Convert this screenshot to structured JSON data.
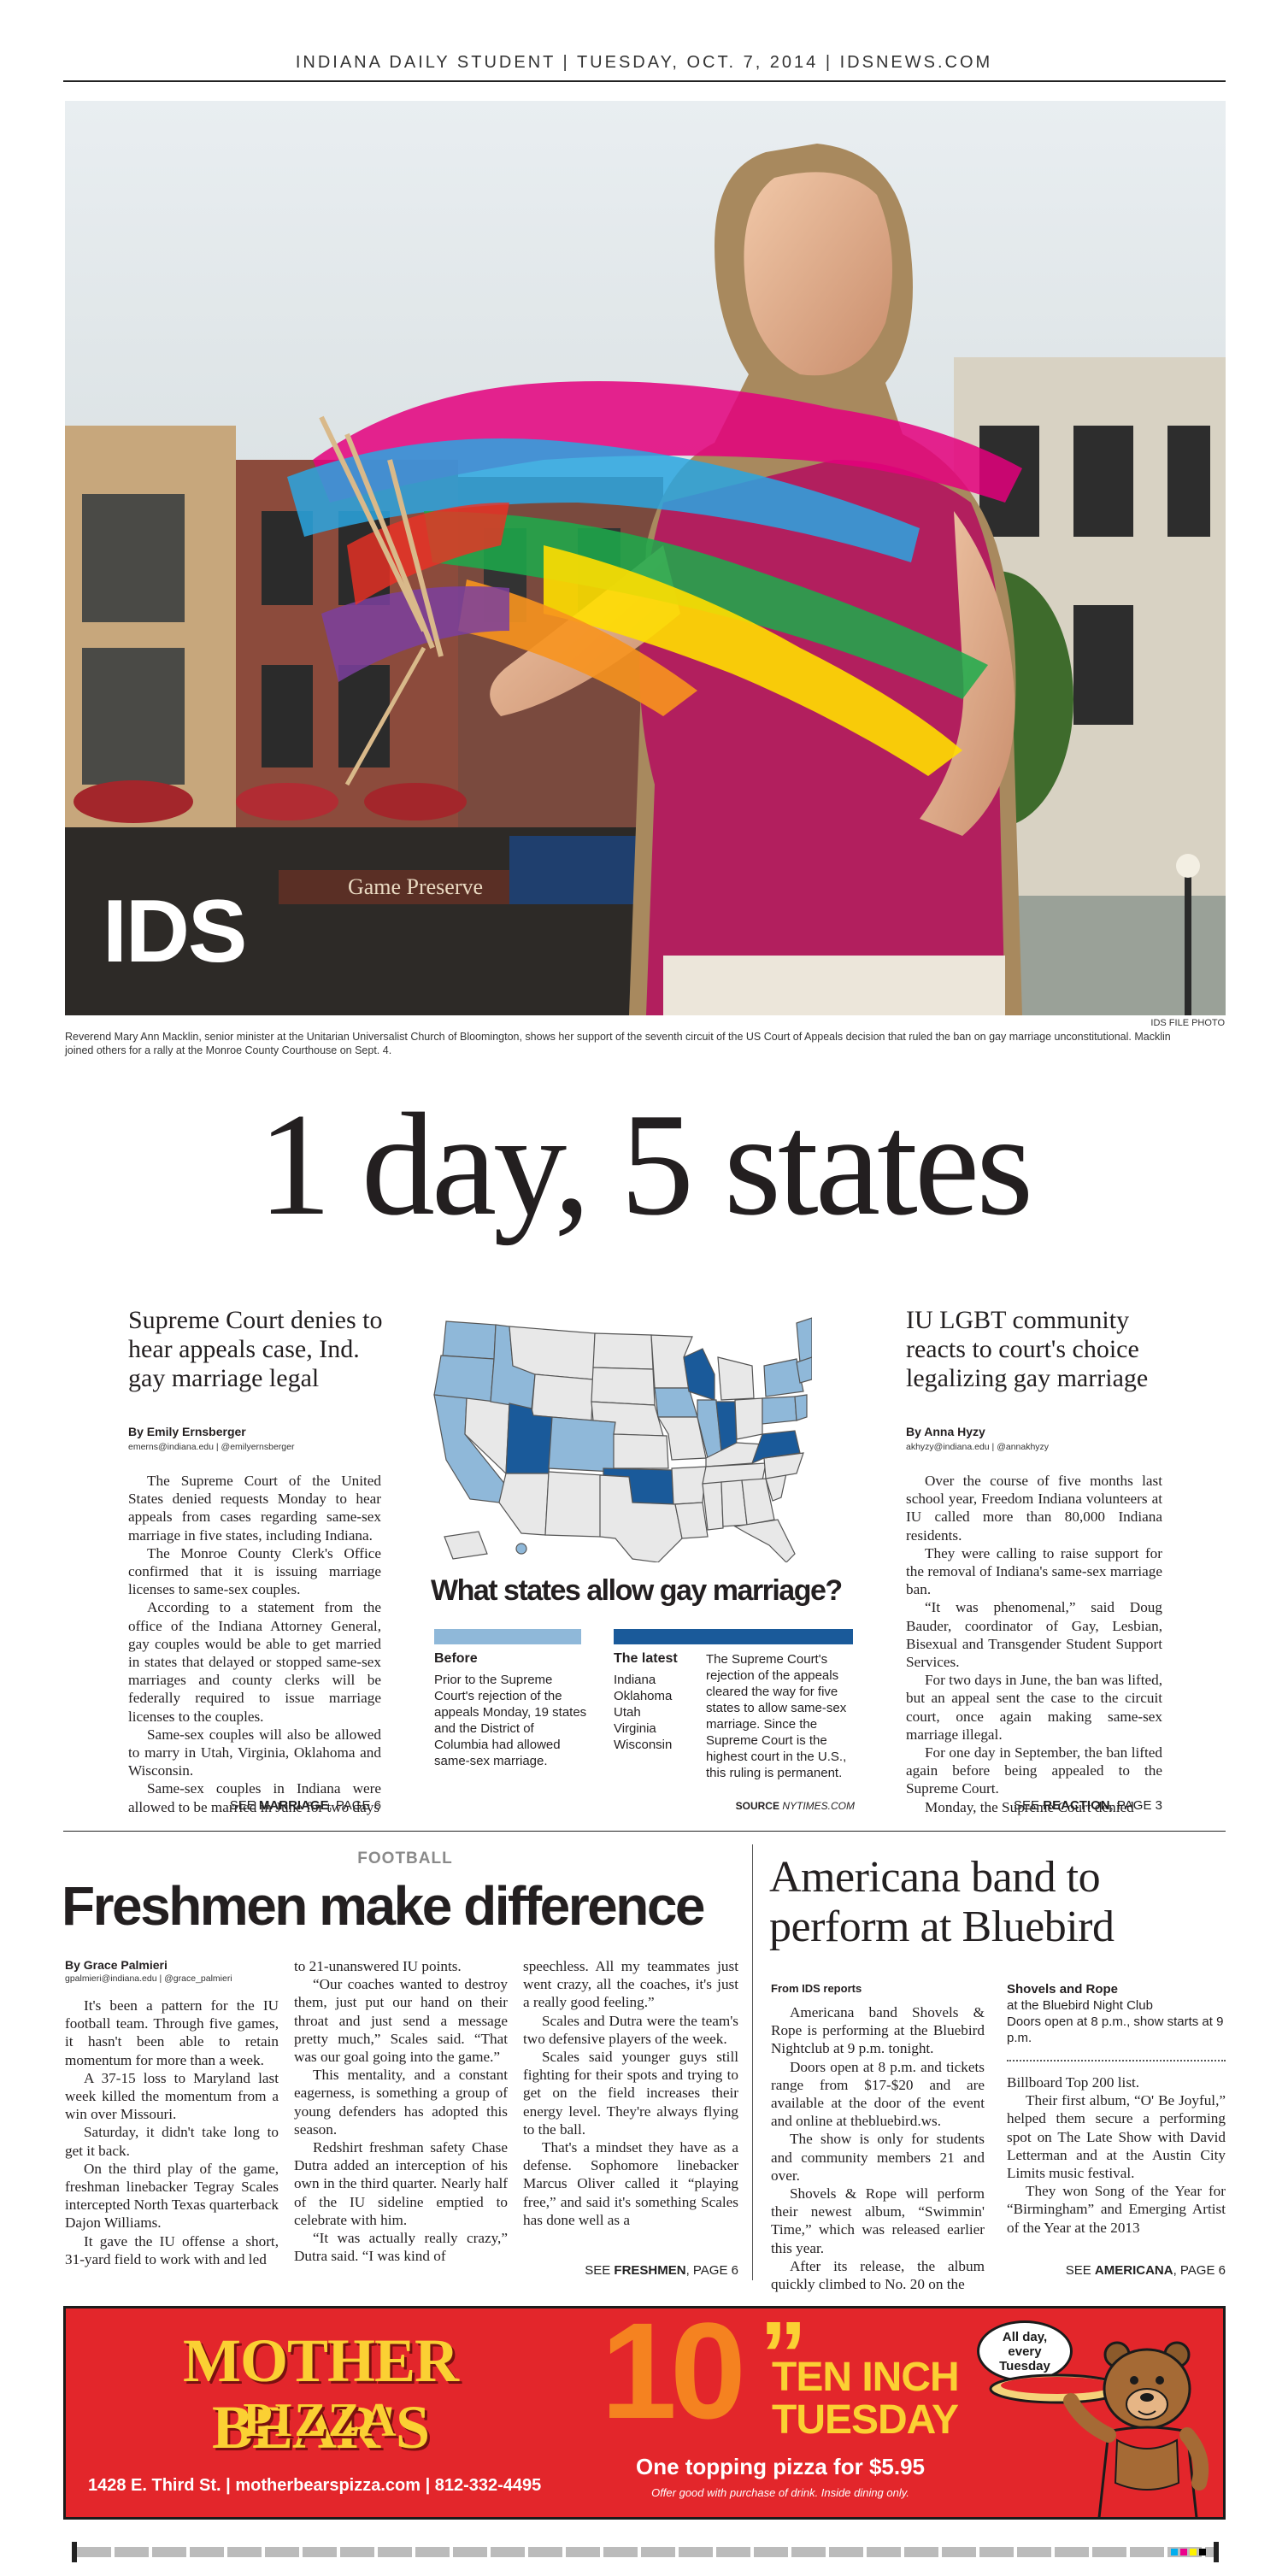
{
  "masthead": "INDIANA DAILY STUDENT | TUESDAY, OCT. 7, 2014 | IDSNEWS.COM",
  "photo": {
    "logo": "IDS",
    "credit": "IDS FILE PHOTO",
    "caption": "Reverend Mary Ann Macklin, senior minister at the Unitarian Universalist Church of Bloomington, shows her support of the seventh circuit of the US Court of Appeals decision that ruled the ban on gay marriage unconstitutional. Macklin joined others for a rally at the Monroe County Courthouse on Sept. 4.",
    "storefront_sign": "Game Preserve"
  },
  "headline": "1 day, 5 states",
  "left_story": {
    "deck": "Supreme Court denies to hear appeals case, Ind. gay marriage legal",
    "byline": "By Emily Ernsberger",
    "contact": "emerns@indiana.edu | @emilyernsberger",
    "paragraphs": [
      "The Supreme Court of the United States denied requests Monday to hear appeals from cases regarding same-sex marriage in five states, including Indiana.",
      "The Monroe County Clerk's Office confirmed that it is issuing marriage licenses to same-sex couples.",
      "According to a statement from the office of the Indiana Attorney General, gay couples would be able to get married in states that delayed or stopped same-sex marriages and county clerks will be federally required to issue marriage licenses to the couples.",
      "Same-sex couples will also be allowed to marry in Utah, Virginia, Oklahoma and Wisconsin.",
      "Same-sex couples in Indiana were allowed to be married in June for two days"
    ],
    "jump_prefix": "SEE ",
    "jump_bold": "MARRIAGE",
    "jump_suffix": ", PAGE 6"
  },
  "graphic": {
    "title": "What states allow gay marriage?",
    "before_label": "Before",
    "before_text": "Prior to the Supreme Court's rejection of the appeals Monday, 19 states and the District of Columbia had allowed same-sex marriage.",
    "latest_label": "The latest",
    "latest_states": [
      "Indiana",
      "Oklahoma",
      "Utah",
      "Virginia",
      "Wisconsin"
    ],
    "latest_text": "The Supreme Court's rejection of the appeals cleared the way for five states to allow same-sex marriage. Since the Supreme Court is the highest court in the U.S., this ruling is permanent.",
    "source_label": "SOURCE",
    "source_value": "NYTIMES.COM",
    "colors": {
      "before": "#8fb8d9",
      "latest": "#1a5a9a",
      "none": "#e8e8e8"
    }
  },
  "right_story": {
    "deck": "IU LGBT community reacts to court's choice legalizing gay marriage",
    "byline": "By Anna Hyzy",
    "contact": "akhyzy@indiana.edu | @annakhyzy",
    "paragraphs": [
      "Over the course of five months last school year, Freedom Indiana volunteers at IU called more than 80,000 Indiana residents.",
      "They were calling to raise support for the removal of Indiana's same-sex marriage ban.",
      "“It was phenomenal,” said Doug Bauder, coordinator of Gay, Lesbian, Bisexual and Transgender Student Support Services.",
      "For two days in June, the ban was lifted, but an appeal sent the case to the circuit court, once again making same-sex marriage illegal.",
      "For one day in September, the ban lifted again before being appealed to the Supreme Court.",
      "Monday, the Supreme Court denied"
    ],
    "jump_prefix": "SEE ",
    "jump_bold": "REACTION",
    "jump_suffix": ", PAGE 3"
  },
  "football": {
    "kicker": "FOOTBALL",
    "headline": "Freshmen make difference",
    "byline": "By Grace Palmieri",
    "contact": "gpalmieri@indiana.edu | @grace_palmieri",
    "col1": [
      "It's been a pattern for the IU football team. Through five games, it hasn't been able to retain momentum for more than a week.",
      "A 37-15 loss to Maryland last week killed the momentum from a win over Missouri.",
      "Saturday, it didn't take long to get it back.",
      "On the third play of the game, freshman linebacker Tegray Scales intercepted North Texas quarterback Dajon Williams.",
      "It gave the IU offense a short, 31-yard field to work with and led"
    ],
    "col2_lead": "to 21-unanswered IU points.",
    "col2": [
      "“Our coaches wanted to destroy them, just put our hand on their throat and just send a message pretty much,” Scales said. “That was our goal going into the game.”",
      "This mentality, and a constant eagerness, is something a group of young defenders has adopted this season.",
      "Redshirt freshman safety Chase Dutra added an interception of his own in the third quarter. Nearly half of the IU sideline emptied to celebrate with him.",
      "“It was actually really crazy,” Dutra said. “I was kind of"
    ],
    "col3_lead": "speechless. All my teammates just went crazy, all the coaches, it's just a really good feeling.”",
    "col3": [
      "Scales and Dutra were the team's two defensive players of the week.",
      "Scales said younger guys still fighting for their spots and trying to get on the field increases their energy level. They're always flying to the ball.",
      "That's a mindset they have as a defense. Sophomore linebacker Marcus Oliver called it “playing free,” and said it's something Scales has done well as a"
    ],
    "jump_prefix": "SEE ",
    "jump_bold": "FRESHMEN",
    "jump_suffix": ", PAGE 6"
  },
  "americana": {
    "headline": "Americana band to perform at Bluebird",
    "byline": "From IDS reports",
    "col1": [
      "Americana band Shovels & Rope is performing at the Bluebird Nightclub at 9 p.m. tonight.",
      "Doors open at 8 p.m. and tickets range from $17-$20 and are available at the door of the event and online at thebluebird.ws.",
      "The show is only for students and community members 21 and over.",
      "Shovels & Rope will perform their newest album, “Swimmin' Time,” which was released earlier this year.",
      "After its release, the album quickly climbed to No. 20 on the"
    ],
    "info_title": "Shovels and Rope",
    "info_lines": [
      "at the Bluebird Night Club",
      "Doors open at 8 p.m., show starts at 9 p.m."
    ],
    "col2_lead": "Billboard Top 200 list.",
    "col2": [
      "Their first album, “O' Be Joyful,” helped them secure a performing spot on The Late Show with David Letterman and at the Austin City Limits music festival.",
      "They won Song of the Year for “Birmingham” and Emerging Artist of the Year at the 2013"
    ],
    "jump_prefix": "SEE ",
    "jump_bold": "AMERICANA",
    "jump_suffix": ", PAGE 6"
  },
  "ad": {
    "brand_line1": "MOTHER BEAR'S",
    "brand_line2": "PIZZA",
    "address": "1428 E. Third St. | motherbearspizza.com | 812-332-4495",
    "big_number": "10",
    "inch_mark": "”",
    "promo_line1": "TEN INCH",
    "promo_line2": "TUESDAY",
    "offer": "One topping pizza for $5.95",
    "fine_print": "Offer good with purchase of drink. Inside dining only.",
    "bubble": "All day, every Tuesday",
    "colors": {
      "red": "#e3262b",
      "yellow": "#fbd033",
      "orange": "#f58220"
    }
  }
}
